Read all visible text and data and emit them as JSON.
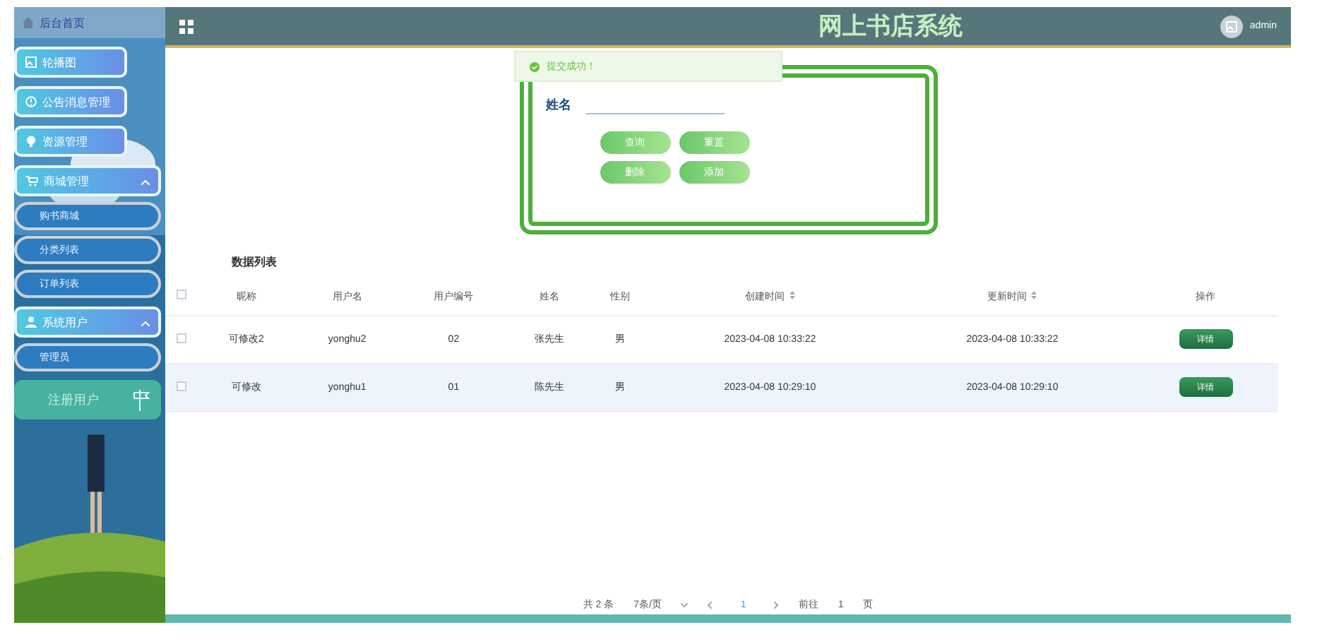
{
  "sidebar": {
    "home": "后台首页",
    "items": [
      {
        "label": "轮播图"
      },
      {
        "label": "公告消息管理"
      },
      {
        "label": "资源管理"
      },
      {
        "label": "商城管理",
        "expanded": true,
        "children": [
          "购书商城",
          "分类列表",
          "订单列表"
        ]
      },
      {
        "label": "系统用户",
        "expanded": true,
        "children": [
          "管理员"
        ]
      }
    ],
    "register": "注册用户"
  },
  "header": {
    "title": "网上书店系统",
    "user": "admin"
  },
  "toast": "提交成功！",
  "search": {
    "label": "姓名",
    "buttons": [
      "查询",
      "重置",
      "删除",
      "添加"
    ]
  },
  "table": {
    "title": "数据列表",
    "all_checked": false,
    "columns": [
      {
        "label": "昵称"
      },
      {
        "label": "用户名"
      },
      {
        "label": "用户编号"
      },
      {
        "label": "姓名"
      },
      {
        "label": "性别"
      },
      {
        "label": "创建时间",
        "sortable": true
      },
      {
        "label": "更新时间",
        "sortable": true
      },
      {
        "label": "操作"
      }
    ],
    "rows": [
      {
        "checked": false,
        "cells": [
          "可修改2",
          "yonghu2",
          "02",
          "张先生",
          "男",
          "2023-04-08 10:33:22",
          "2023-04-08 10:33:22"
        ],
        "action": "详情",
        "hovered": false
      },
      {
        "checked": false,
        "cells": [
          "可修改",
          "yonghu1",
          "01",
          "陈先生",
          "男",
          "2023-04-08 10:29:10",
          "2023-04-08 10:29:10"
        ],
        "action": "详情",
        "hovered": true
      }
    ]
  },
  "pagination": {
    "total": "共 2 条",
    "page_size": "7条/页",
    "current": "1",
    "goto": "前往",
    "goto_value": "1",
    "page_unit": "页"
  }
}
